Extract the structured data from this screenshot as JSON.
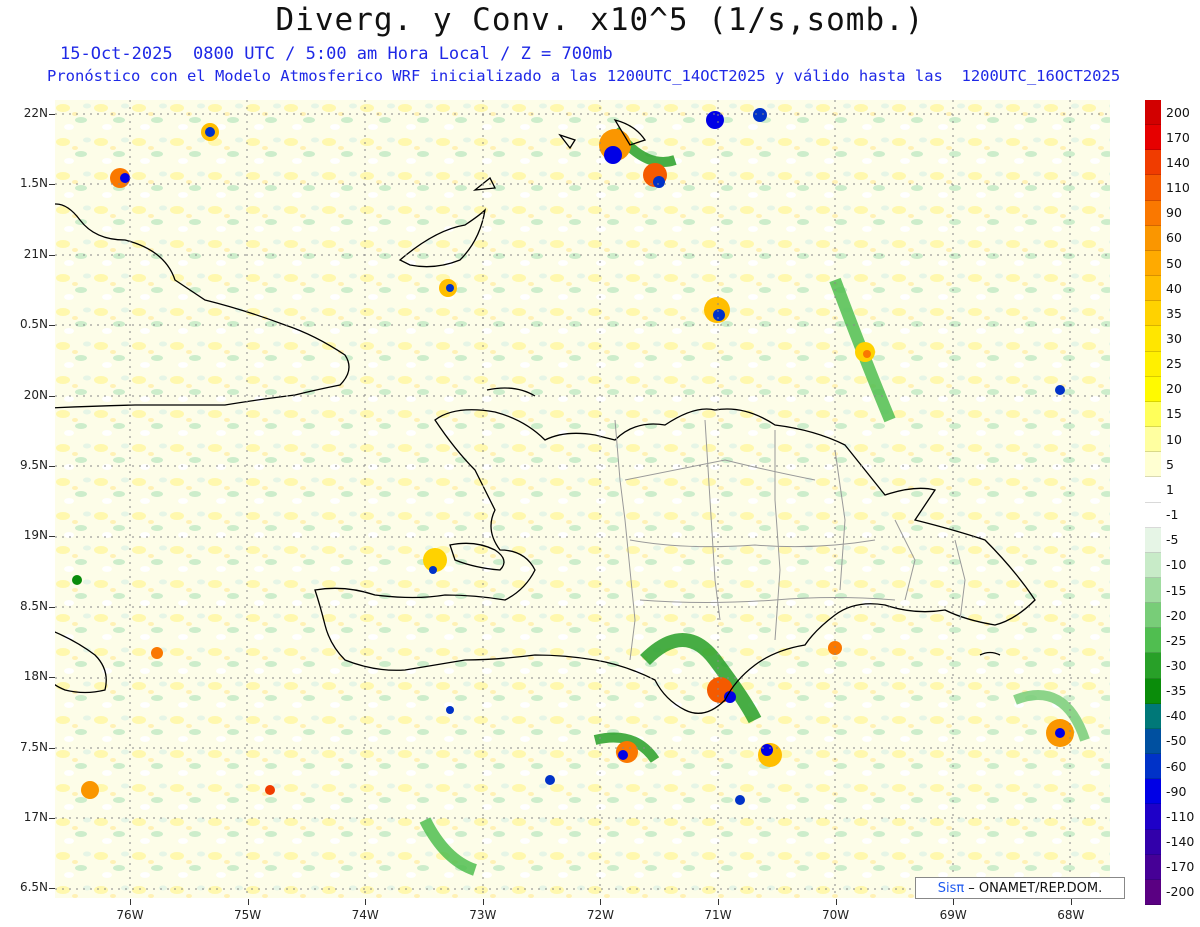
{
  "title": "Diverg. y Conv. x10^5 (1/s,somb.)",
  "subtitle_line1": "15-Oct-2025  0800 UTC / 5:00 am Hora Local / Z = 700mb",
  "subtitle_line2": "Pronóstico con el Modelo Atmosferico WRF inicializado a las 1200UTC_14OCT2025 y válido hasta las  1200UTC_16OCT2025",
  "lat_labels": [
    "22N",
    "1.5N",
    "21N",
    "0.5N",
    "20N",
    "9.5N",
    "19N",
    "8.5N",
    "18N",
    "7.5N",
    "17N",
    "6.5N"
  ],
  "lon_labels": [
    "76W",
    "75W",
    "74W",
    "73W",
    "72W",
    "71W",
    "70W",
    "69W",
    "68W"
  ],
  "colorbar": {
    "labels": [
      "200",
      "170",
      "140",
      "110",
      "90",
      "60",
      "50",
      "40",
      "35",
      "30",
      "25",
      "20",
      "15",
      "10",
      "5",
      "1",
      "-1",
      "-5",
      "-10",
      "-15",
      "-20",
      "-25",
      "-30",
      "-35",
      "-40",
      "-50",
      "-60",
      "-90",
      "-110",
      "-140",
      "-170",
      "-200"
    ],
    "colors": [
      "#d20000",
      "#e60000",
      "#f03c00",
      "#f55a00",
      "#fa7800",
      "#fa9600",
      "#ffaa00",
      "#ffbe00",
      "#ffd200",
      "#ffe600",
      "#fff000",
      "#fffa00",
      "#ffff5a",
      "#ffffa0",
      "#ffffd2",
      "#ffffff",
      "#ffffff",
      "#e6f5e6",
      "#c8ebc8",
      "#a0dca0",
      "#78cd78",
      "#50be50",
      "#28a028",
      "#0a8c0a",
      "#007878",
      "#0050a0",
      "#0032c8",
      "#0000e6",
      "#1e00c8",
      "#3200aa",
      "#460096",
      "#5a0082"
    ]
  },
  "credit": {
    "brand": "Sisπ",
    "text": "– ONAMET/REP.DOM."
  }
}
